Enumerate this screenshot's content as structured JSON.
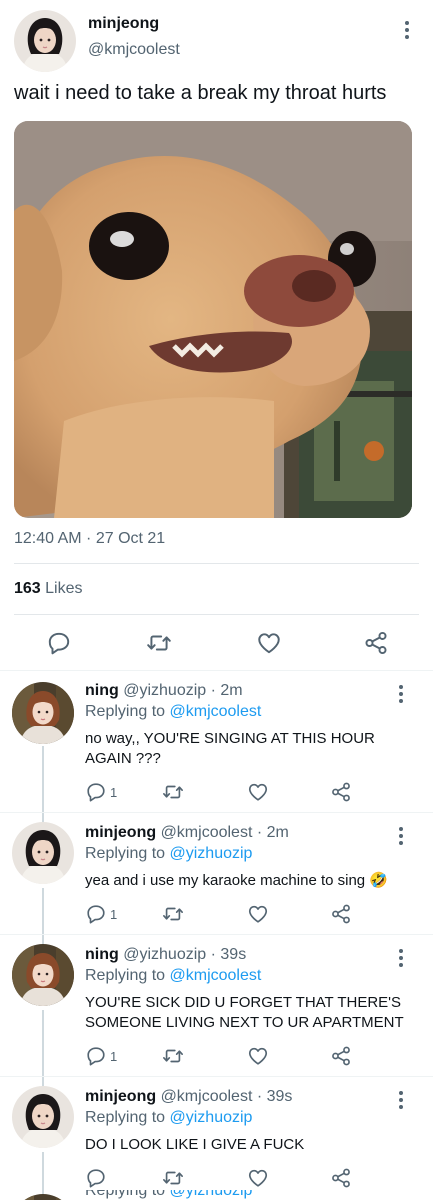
{
  "main_tweet": {
    "author_name": "minjeong",
    "author_handle": "@kmjcoolest",
    "text": "wait i need to take a break my throat hurts",
    "timestamp": "12:40 AM · 27 Oct 21",
    "likes_count": "163",
    "likes_label": "Likes"
  },
  "replies": [
    {
      "author_name": "ning",
      "author_handle": "@yizhuozip",
      "time": "· 2m",
      "replying_prefix": "Replying to",
      "replying_to": "@kmjcoolest",
      "text": "no way,, YOU'RE SINGING AT THIS HOUR AGAIN ???",
      "reply_count": "1"
    },
    {
      "author_name": "minjeong",
      "author_handle": "@kmjcoolest",
      "time": "· 2m",
      "replying_prefix": "Replying to",
      "replying_to": "@yizhuozip",
      "text": "yea and i use my karaoke machine to sing 🤣",
      "reply_count": "1"
    },
    {
      "author_name": "ning",
      "author_handle": "@yizhuozip",
      "time": "· 39s",
      "replying_prefix": "Replying to",
      "replying_to": "@kmjcoolest",
      "text": "YOU'RE SICK DID U FORGET THAT THERE'S SOMEONE LIVING NEXT TO UR APARTMENT",
      "reply_count": "1"
    },
    {
      "author_name": "minjeong",
      "author_handle": "@kmjcoolest",
      "time": "· 39s",
      "replying_prefix": "Replying to",
      "replying_to": "@yizhuozip",
      "text": "DO I LOOK LIKE I GIVE A FUCK",
      "reply_count": ""
    }
  ],
  "partial_next": {
    "replying_prefix": "Replying to",
    "replying_to": "@yizhuozip"
  },
  "colors": {
    "icon_gray": "#536471",
    "link_blue": "#1d9bf0",
    "text": "#0f1419"
  },
  "icons": [
    "reply-icon",
    "retweet-icon",
    "like-icon",
    "share-icon",
    "more-icon"
  ]
}
